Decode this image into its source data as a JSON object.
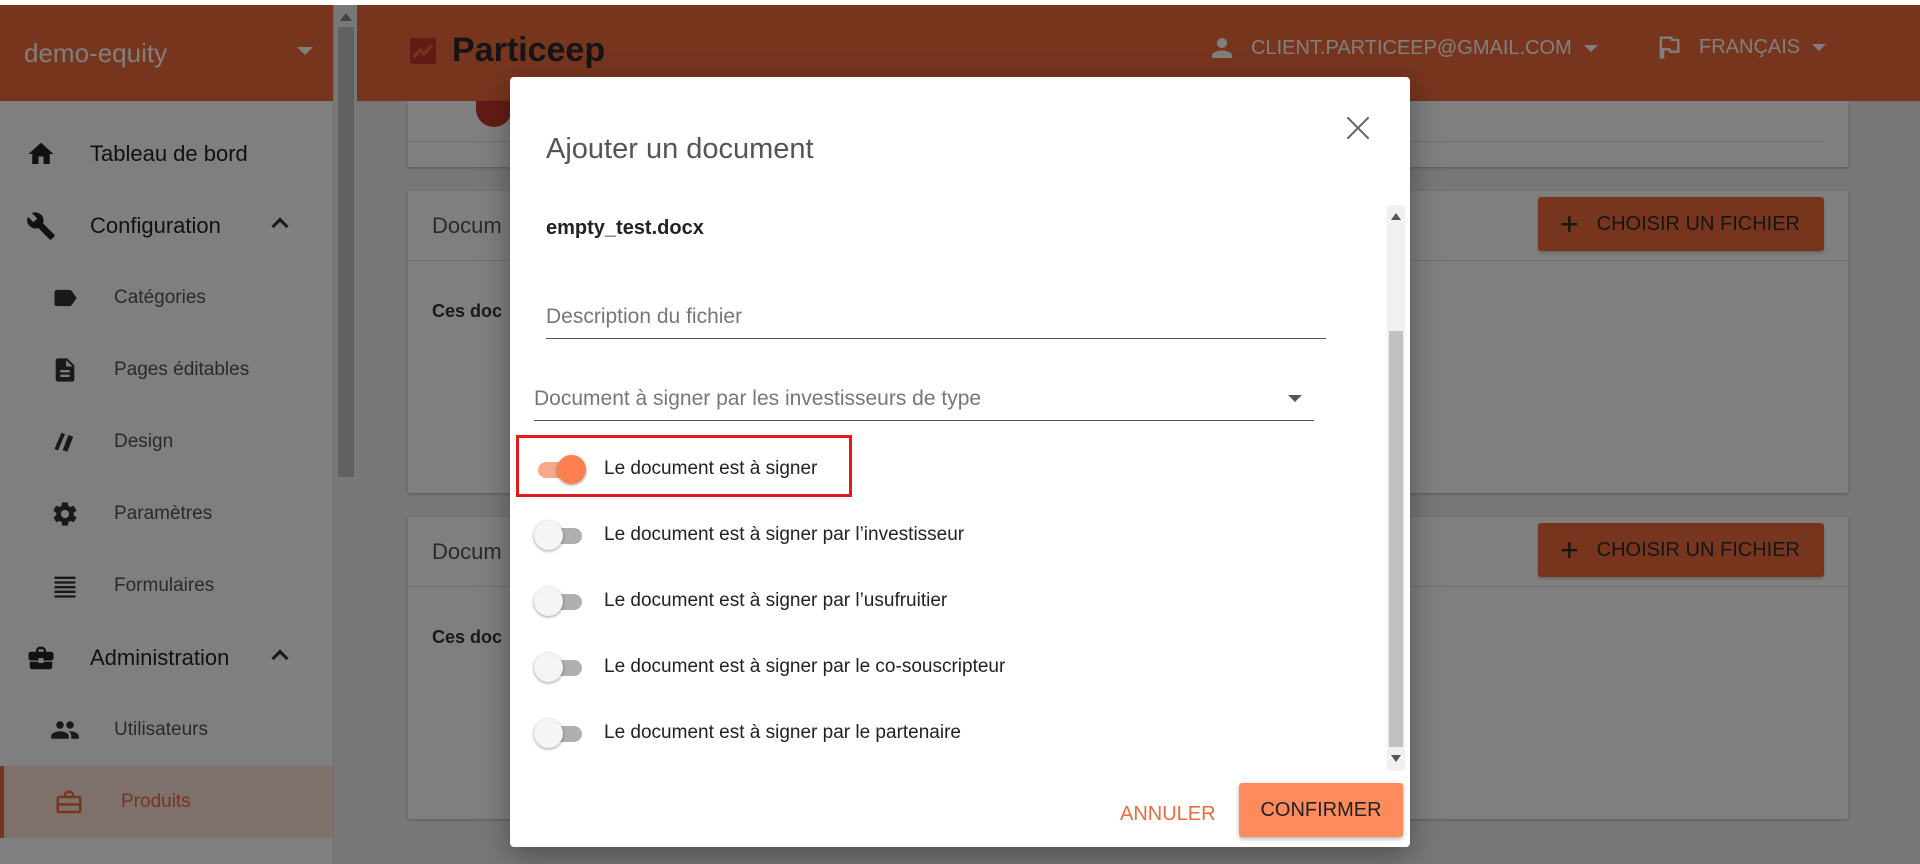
{
  "sidebar": {
    "workspace": "demo-equity",
    "items": [
      {
        "label": "Tableau de bord",
        "icon": "home-icon"
      },
      {
        "label": "Configuration",
        "icon": "wrench-icon"
      },
      {
        "label": "Catégories",
        "icon": "label-icon"
      },
      {
        "label": "Pages éditables",
        "icon": "document-icon"
      },
      {
        "label": "Design",
        "icon": "palette-icon"
      },
      {
        "label": "Paramètres",
        "icon": "gear-icon"
      },
      {
        "label": "Formulaires",
        "icon": "list-icon"
      },
      {
        "label": "Administration",
        "icon": "briefcase-icon"
      },
      {
        "label": "Utilisateurs",
        "icon": "users-icon"
      },
      {
        "label": "Produits",
        "icon": "briefcase-icon"
      }
    ]
  },
  "topbar": {
    "brand": "Particeep",
    "account": "CLIENT.PARTICEEP@GMAIL.COM",
    "language": "FRANÇAIS"
  },
  "background": {
    "card1_title": "Docum",
    "card1_text": "Ces doc",
    "card2_title": "Docum",
    "card2_text": "Ces doc",
    "choose_file": "CHOISIR UN FICHIER"
  },
  "modal": {
    "title": "Ajouter un document",
    "file_name": "empty_test.docx",
    "description_placeholder": "Description du fichier",
    "signer_type_placeholder": "Document à signer par les investisseurs de type",
    "toggles": [
      {
        "label": "Le document est à signer",
        "on": true
      },
      {
        "label": "Le document est à signer par l’investisseur",
        "on": false
      },
      {
        "label": "Le document est à signer par l’usufruitier",
        "on": false
      },
      {
        "label": "Le document est à signer par le co-souscripteur",
        "on": false
      },
      {
        "label": "Le document est à signer par le partenaire",
        "on": false
      }
    ],
    "cancel": "ANNULER",
    "confirm": "CONFIRMER"
  },
  "colors": {
    "brand": "#ef6b3d",
    "toggle_on": "#ff7f50",
    "highlight": "#e01b1b"
  }
}
